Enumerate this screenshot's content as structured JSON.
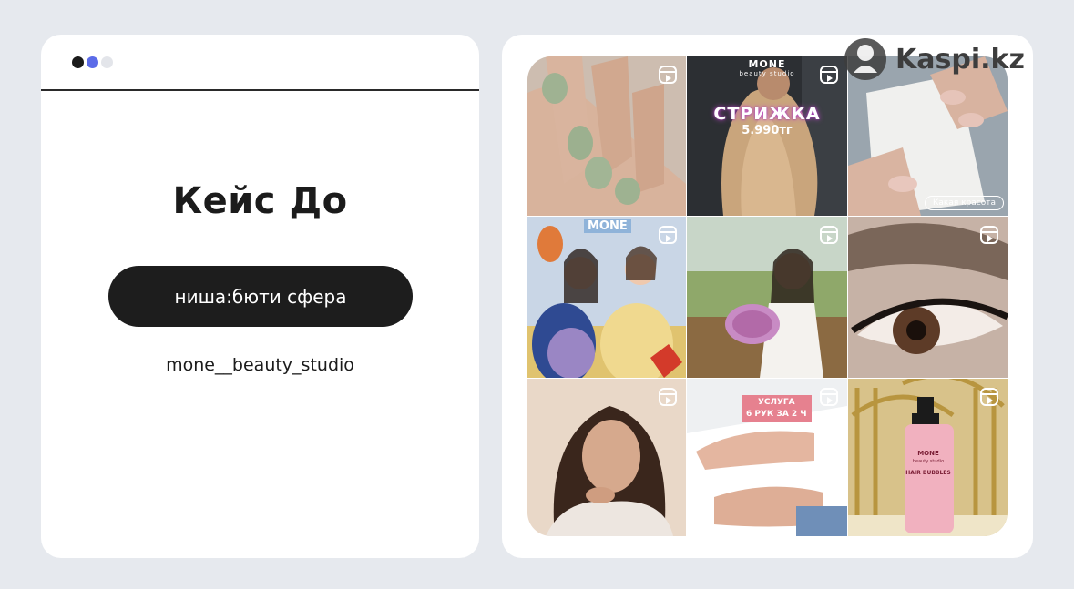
{
  "left_card": {
    "window_dots": [
      "#1b1b1b",
      "#5b6be8",
      "#e3e5ea"
    ],
    "title": "Кейс До",
    "niche_label": "ниша:бюти сфера",
    "account_handle": "mone__beauty_studio"
  },
  "watermark": {
    "text": "Kaspi.kz"
  },
  "feed": {
    "tiles": [
      {
        "subject": "green manicure",
        "badge_text": ""
      },
      {
        "subject": "haircut promo",
        "brand": "MONE",
        "brand_sub": "beauty studio",
        "headline": "СТРИЖКА",
        "price": "5.990тг"
      },
      {
        "subject": "nude manicure",
        "caption": "Какая красота"
      },
      {
        "subject": "animated characters with clients",
        "brand": "MONE"
      },
      {
        "subject": "woman with bouquet",
        "badge_text": ""
      },
      {
        "subject": "eyelash extensions",
        "badge_text": ""
      },
      {
        "subject": "portrait",
        "badge_text": ""
      },
      {
        "subject": "pedicure promo",
        "line1": "УСЛУГА",
        "line2": "6 РУК ЗА 2 Ч"
      },
      {
        "subject": "hair product",
        "bottle_brand": "MONE",
        "bottle_sub": "beauty studio",
        "bottle_name": "HAIR BUBBLES"
      }
    ],
    "icon": "reels-icon"
  }
}
